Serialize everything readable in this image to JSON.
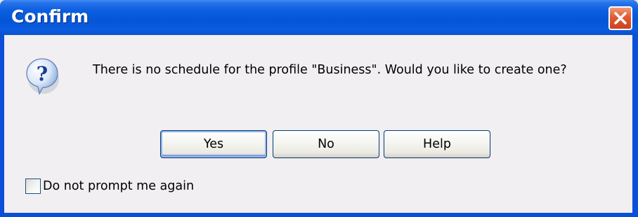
{
  "dialog": {
    "title": "Confirm",
    "message": "There is no schedule for the profile \"Business\". Would you like to create one?",
    "icon": "question-icon",
    "buttons": {
      "yes": "Yes",
      "no": "No",
      "help": "Help"
    },
    "checkbox": {
      "label": "Do not prompt me again",
      "checked": false
    }
  },
  "colors": {
    "titlebar": "#0655d6",
    "close_button": "#e25a30",
    "client_background": "#f1eff1",
    "button_border": "#003c74"
  }
}
